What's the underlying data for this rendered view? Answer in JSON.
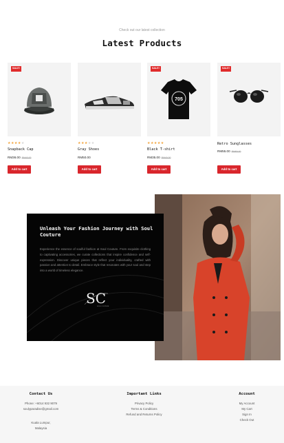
{
  "section": {
    "subheading": "Check out our latest collection",
    "title": "Latest Products"
  },
  "products": [
    {
      "badge": "SALE!",
      "name": "Snapback Cap",
      "price": "RM36.00",
      "old_price": "RM40.00",
      "rating": 4,
      "cart": "Add to cart",
      "icon": "cap-image"
    },
    {
      "badge": "",
      "name": "Gray Shoes",
      "price": "RM50.00",
      "old_price": "",
      "rating": 3,
      "cart": "Add to cart",
      "icon": "shoes-image"
    },
    {
      "badge": "SALE!",
      "name": "Black T-shirt",
      "price": "RM35.00",
      "old_price": "RM40.00",
      "rating": 5,
      "cart": "Add to cart",
      "icon": "tshirt-image"
    },
    {
      "badge": "SALE!",
      "name": "Retro Sunglasses",
      "price": "RM55.00",
      "old_price": "RM60.00",
      "rating": 0,
      "cart": "Add to cart",
      "icon": "sunglasses-image"
    }
  ],
  "promo": {
    "title": "Unleash Your Fashion Journey with Soul Couture",
    "text": "Experience the essence of soulful fashion at Soul Couture. From exquisite clothing to captivating accessories, we curate collections that inspire confidence and self-expression. Discover unique pieces that reflect your individuality, crafted with passion and attention to detail. Embrace style that resonates with your soul and step into a world of timeless elegance.",
    "logo": "SC",
    "logo_sub": "SOUL COUTURE"
  },
  "footer": {
    "contact": {
      "heading": "Contact Us",
      "phone": "Phone: +6014 932 9079",
      "email": "soulyparadise@gmail.com",
      "city": "Kuala Lumpur,",
      "country": "Malaysia"
    },
    "links": {
      "heading": "Important Links",
      "items": [
        "Privacy Policy",
        "Terms & Conditions",
        "Refund and Returns Policy"
      ]
    },
    "account": {
      "heading": "Account",
      "items": [
        "My Account",
        "My Cart",
        "Sign In",
        "Check Out"
      ]
    }
  },
  "colors": {
    "sale_badge": "#e02b2b",
    "cart_button": "#d9262c",
    "star": "#f2a33a",
    "promo_bg": "#050505"
  }
}
